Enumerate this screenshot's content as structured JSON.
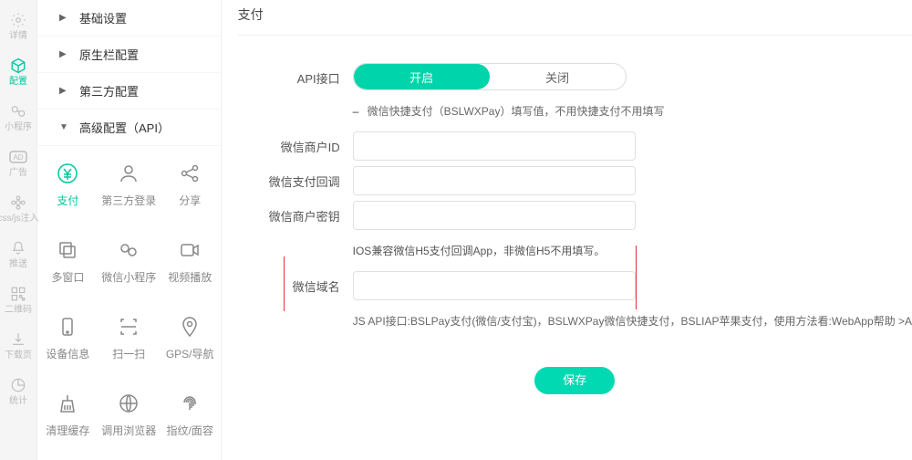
{
  "rail": [
    {
      "label": "详情",
      "icon": "gear"
    },
    {
      "label": "配置",
      "icon": "cube",
      "active": true
    },
    {
      "label": "小程序",
      "icon": "wand"
    },
    {
      "label": "广告",
      "icon": "ad"
    },
    {
      "label": "css/js注入",
      "icon": "flower"
    },
    {
      "label": "推送",
      "icon": "bell"
    },
    {
      "label": "二维码",
      "icon": "qr"
    },
    {
      "label": "下载页",
      "icon": "download"
    },
    {
      "label": "统计",
      "icon": "chart"
    }
  ],
  "tree": [
    {
      "label": "基础设置",
      "expanded": false
    },
    {
      "label": "原生栏配置",
      "expanded": false
    },
    {
      "label": "第三方配置",
      "expanded": false
    },
    {
      "label": "高级配置（API）",
      "expanded": true
    }
  ],
  "grid": [
    {
      "label": "支付",
      "icon": "yen",
      "active": true
    },
    {
      "label": "第三方登录",
      "icon": "user"
    },
    {
      "label": "分享",
      "icon": "share"
    },
    {
      "label": "多窗口",
      "icon": "windows"
    },
    {
      "label": "微信小程序",
      "icon": "mini"
    },
    {
      "label": "视频播放",
      "icon": "video"
    },
    {
      "label": "设备信息",
      "icon": "device"
    },
    {
      "label": "扫一扫",
      "icon": "scan"
    },
    {
      "label": "GPS/导航",
      "icon": "pin"
    },
    {
      "label": "清理缓存",
      "icon": "broom"
    },
    {
      "label": "调用浏览器",
      "icon": "globe"
    },
    {
      "label": "指纹/面容",
      "icon": "fingerprint"
    }
  ],
  "main": {
    "title": "支付",
    "api_label": "API接口",
    "toggle_on": "开启",
    "toggle_off": "关闭",
    "hint1": "微信快捷支付（BSLWXPay）填写值，不用快捷支付不用填写",
    "f_mchid": "微信商户ID",
    "f_callback": "微信支付回调",
    "f_secret": "微信商户密钥",
    "hint2": "IOS兼容微信H5支付回调App，非微信H5不用填写。",
    "f_domain": "微信域名",
    "hint3": "JS API接口:BSLPay支付(微信/支付宝)，BSLWXPay微信快捷支付，BSLIAP苹果支付，使用方法看:WebApp帮助 >A",
    "save": "保存"
  }
}
